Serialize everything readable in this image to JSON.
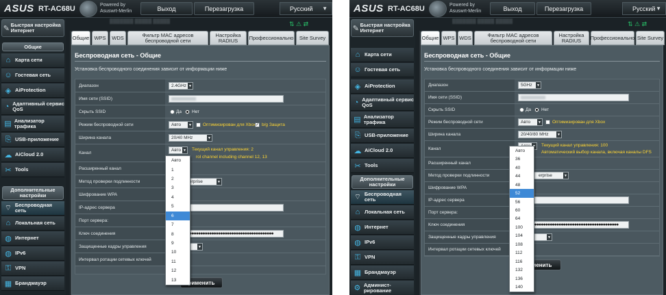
{
  "brand": {
    "logo": "ASUS",
    "model": "RT-AC68U",
    "powered_line1": "Powered by",
    "powered_line2": "Asuswrt-Merlin"
  },
  "topbar": {
    "logout": "Выход",
    "reboot": "Перезагрузка",
    "language": "Русский"
  },
  "sidebar": {
    "quick_setup": "Быстрая настройка Интернет",
    "general_header": "Общие",
    "items": [
      "Карта сети",
      "Гостевая сеть",
      "AiProtection",
      "Адаптивный сервис QoS",
      "Анализатор трафика",
      "USB-приложение",
      "AiCloud 2.0",
      "Tools"
    ],
    "advanced_header": "Дополнительные настройки",
    "adv_items": [
      "Беспроводная сеть",
      "Локальная сеть",
      "Интернет",
      "IPv6",
      "VPN",
      "Брандмауэр",
      "Админист­рирование"
    ]
  },
  "tabs": [
    "Общие",
    "WPS",
    "WDS",
    "Фильтр MAC адресов беспроводной сети",
    "Настройка RADIUS",
    "Профессионально",
    "Site Survey"
  ],
  "page": {
    "title": "Беспроводная сеть - Общие",
    "description": "Установка беспроводного соединения зависит от информации ниже"
  },
  "labels": {
    "band": "Диапазон",
    "ssid": "Имя сети (SSID)",
    "hide": "Скрыть SSID",
    "mode": "Режим беспроводной сети",
    "width": "Ширина канала",
    "channel": "Канал",
    "ext": "Расширенный канал",
    "auth": "Метод проверки подлинности",
    "wpa": "Шифрование WPA",
    "ip": "IP-адрес сервера",
    "port": "Порт сервера:",
    "key": "Ключ соединения",
    "pmf": "Защищенные кадры управления",
    "rotation": "Интервал ротации сетевых ключей"
  },
  "common": {
    "yes": "Да",
    "no": "Нет",
    "mode_value": "Авто",
    "xbox": "Оптимизирован для Xbox",
    "bg": "b/g Защита",
    "channel_value": "Авто",
    "apply": "Применить",
    "auth_partial": "erprise",
    "apply_partial": "рименить"
  },
  "left": {
    "band": "2.4GHz",
    "width": "20/40 MHz",
    "channel_note": "Текущий канал управления: 2",
    "channel_note2": "rol channel including channel 12, 13",
    "dropdown": [
      "Авто",
      "1",
      "2",
      "3",
      "4",
      "5",
      "6",
      "7",
      "8",
      "9",
      "10",
      "11",
      "12",
      "13"
    ],
    "highlight": 6
  },
  "right": {
    "band": "5GHz",
    "width": "20/40/80 MHz",
    "channel_note": "Текущий канал управления: 100",
    "channel_note2": "Автоматический выбор канала, включая каналы DFS",
    "dropdown": [
      "Авто",
      "36",
      "40",
      "44",
      "48",
      "52",
      "56",
      "60",
      "64",
      "100",
      "104",
      "108",
      "112",
      "116",
      "132",
      "136",
      "140"
    ],
    "highlight": 5
  },
  "colors": {
    "accent": "#3e89d6",
    "highlight_text": "#ffd633",
    "panel_bg": "#1b2226"
  }
}
